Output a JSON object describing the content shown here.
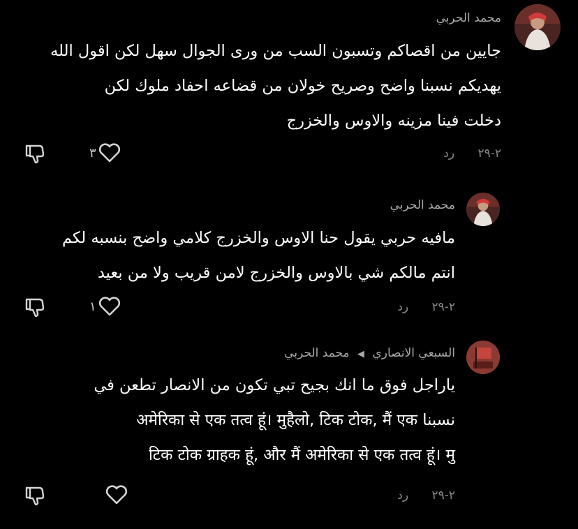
{
  "comments": [
    {
      "author": "محمد الحربي",
      "lines": [
        "جايين من اقصاكم وتسبون السب من ورى الجوال سهل لكن اقول الله",
        "يهديكم نسبنا واضح وصريح خولان من قضاعه احفاد ملوك لكن",
        "دخلت فينا مزينه والاوس والخزرج"
      ],
      "date": "٢-٢٩",
      "reply_label": "رد",
      "likes": "٣"
    },
    {
      "author": "محمد الحربي",
      "lines": [
        "مافيه حربي يقول حنا الاوس والخزرج كلامي واضح بنسبه لكم",
        "انتم مالكم شي بالاوس والخزرج لامن قريب ولا من بعيد"
      ],
      "date": "٢-٢٩",
      "reply_label": "رد",
      "likes": "١"
    },
    {
      "author": "السبعي الانصاري",
      "reply_to": "محمد الحربي",
      "lines": [
        "ياراجل فوق ما انك بجيح تبي تكون من الانصار تطعن في",
        "نسبنا  अमेरिका से एक तत्व हूं। मुहैलो, टिक टोक, मैं एक",
        "टिक टोक ग्राहक हूं, और मैं अमेरिका से एक तत्व हूं। मु"
      ],
      "date": "٢-٢٩",
      "reply_label": "رد",
      "likes": ""
    }
  ],
  "icons": {
    "like": "heart-outline-icon",
    "dislike": "thumbs-down-outline-icon",
    "reply_arrow": "triangle-left-icon"
  },
  "colors": {
    "background": "#000000",
    "text": "#ffffff",
    "secondary": "#a9a9a9"
  }
}
